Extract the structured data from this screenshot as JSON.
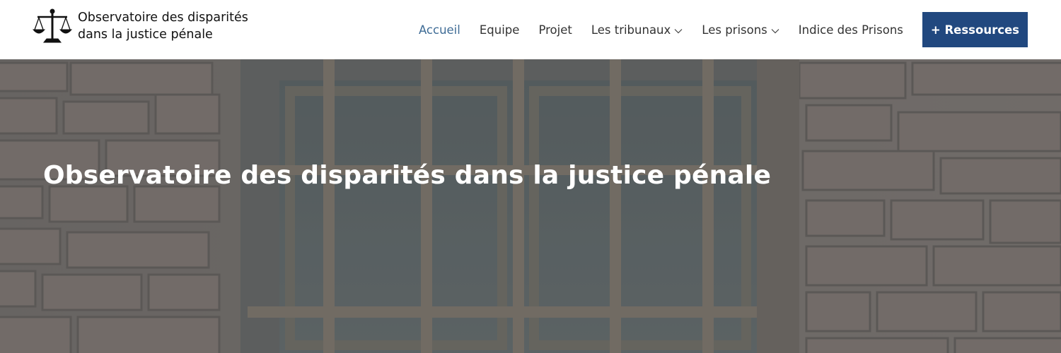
{
  "site": {
    "name_line1": "Observatoire des disparités",
    "name_line2": "dans la justice pénale",
    "logo_icon": "scales-of-justice-icon"
  },
  "nav": {
    "items": [
      {
        "label": "Accueil",
        "active": true
      },
      {
        "label": "Equipe"
      },
      {
        "label": "Projet"
      },
      {
        "label": "Les tribunaux",
        "dropdown": true
      },
      {
        "label": "Les prisons",
        "dropdown": true
      },
      {
        "label": "Indice des Prisons"
      }
    ],
    "cta_label": "+ Ressources"
  },
  "hero": {
    "title": "Observatoire des disparités dans la justice pénale"
  },
  "colors": {
    "active_link": "#3f6c96",
    "cta_background": "#21487f",
    "nav_text": "#333333"
  }
}
